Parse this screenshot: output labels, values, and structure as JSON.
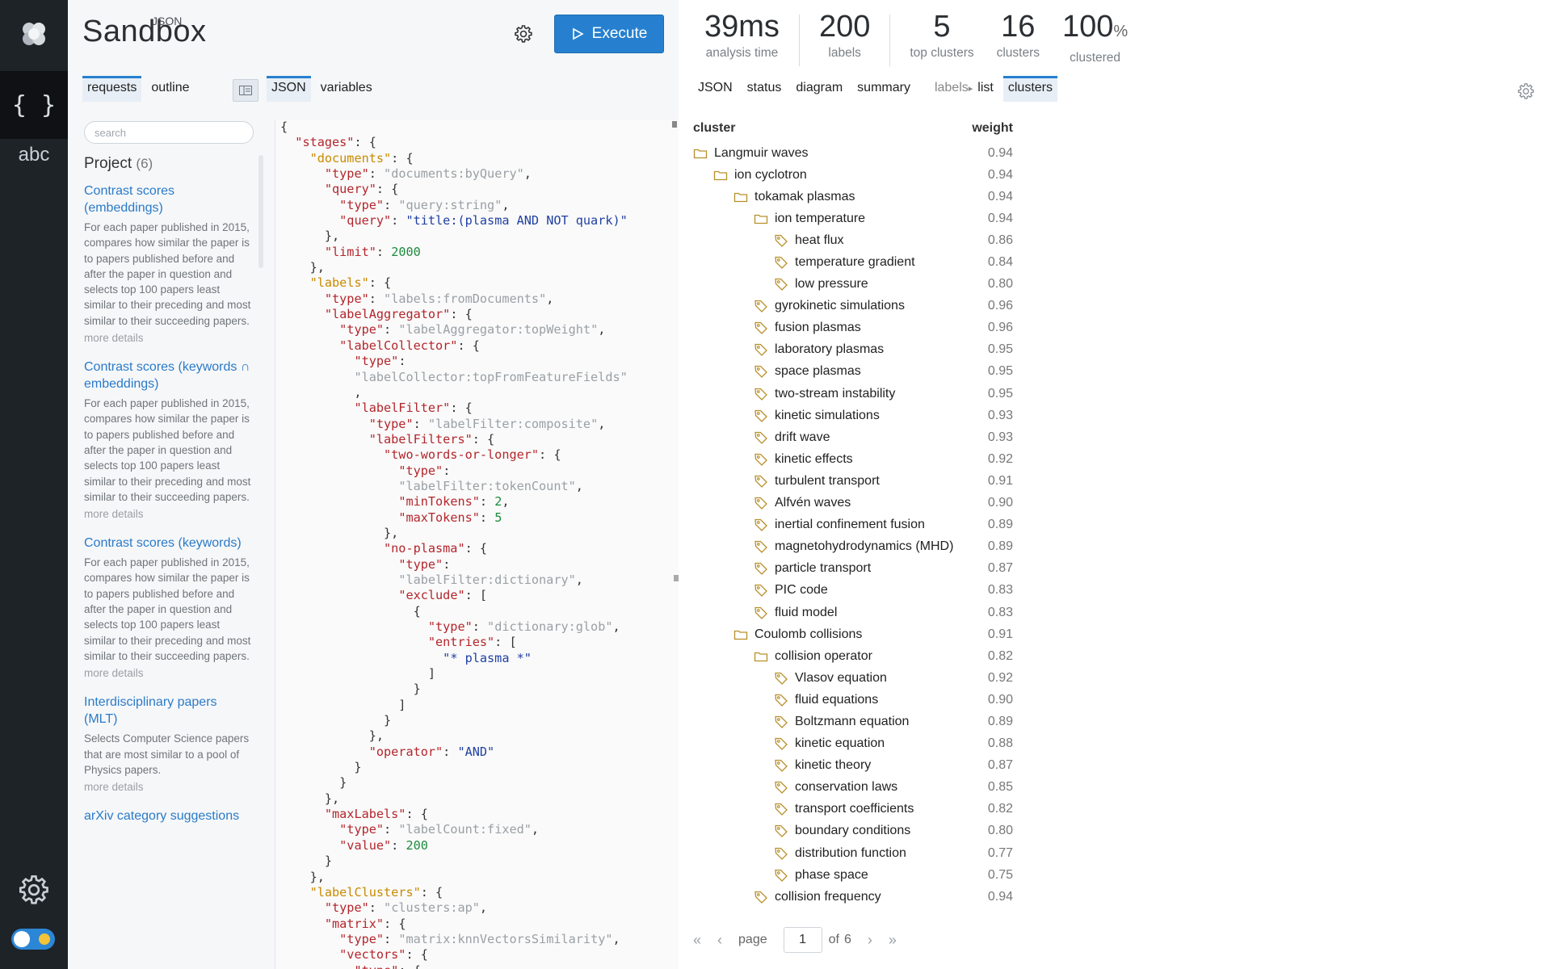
{
  "app": {
    "title": "Sandbox",
    "title_sup": "JSON"
  },
  "rail": {
    "json_icon": "{ }",
    "abc_label": "abc"
  },
  "toolbar": {
    "execute_label": "Execute"
  },
  "request_tabs": [
    "requests",
    "outline"
  ],
  "editor_tabs": [
    "JSON",
    "variables"
  ],
  "search": {
    "placeholder": "search",
    "value": ""
  },
  "project": {
    "heading": "Project",
    "count": "(6)",
    "items": [
      {
        "title": "Contrast scores (embeddings)",
        "desc": "For each paper published in 2015, compares how similar the paper is to papers published before and after the paper in question and selects top 100 papers least similar to their preceding and most similar to their succeeding papers.",
        "more": "more details"
      },
      {
        "title": "Contrast scores (keywords ∩ embeddings)",
        "desc": "For each paper published in 2015, compares how similar the paper is to papers published before and after the paper in question and selects top 100 papers least similar to their preceding and most similar to their succeeding papers.",
        "more": "more details"
      },
      {
        "title": "Contrast scores (keywords)",
        "desc": "For each paper published in 2015, compares how similar the paper is to papers published before and after the paper in question and selects top 100 papers least similar to their preceding and most similar to their succeeding papers.",
        "more": "more details"
      },
      {
        "title": "Interdisciplinary papers (MLT)",
        "desc": "Selects Computer Science papers that are most similar to a pool of Physics papers.",
        "more": "more details"
      },
      {
        "title": "arXiv category suggestions",
        "desc": "",
        "more": ""
      }
    ]
  },
  "stats": [
    {
      "value": "39",
      "unit": "ms",
      "label": "analysis time"
    },
    {
      "value": "200",
      "unit": "",
      "label": "labels"
    },
    {
      "value": "5",
      "unit": "",
      "label": "top clusters"
    },
    {
      "value": "16",
      "unit": "",
      "label": "clusters"
    },
    {
      "value": "100",
      "unit": "%",
      "label": "clustered"
    }
  ],
  "result_tabs": [
    "JSON",
    "status",
    "diagram",
    "summary",
    "labels",
    "list",
    "clusters"
  ],
  "table": {
    "col_cluster": "cluster",
    "col_weight": "weight",
    "rows": [
      {
        "depth": 0,
        "icon": "folder",
        "name": "Langmuir waves",
        "weight": "0.94"
      },
      {
        "depth": 1,
        "icon": "folder",
        "name": "ion cyclotron",
        "weight": "0.94"
      },
      {
        "depth": 2,
        "icon": "folder",
        "name": "tokamak plasmas",
        "weight": "0.94"
      },
      {
        "depth": 3,
        "icon": "folder",
        "name": "ion temperature",
        "weight": "0.94"
      },
      {
        "depth": 4,
        "icon": "tag",
        "name": "heat flux",
        "weight": "0.86"
      },
      {
        "depth": 4,
        "icon": "tag",
        "name": "temperature gradient",
        "weight": "0.84"
      },
      {
        "depth": 4,
        "icon": "tag",
        "name": "low pressure",
        "weight": "0.80"
      },
      {
        "depth": 3,
        "icon": "tag",
        "name": "gyrokinetic simulations",
        "weight": "0.96"
      },
      {
        "depth": 3,
        "icon": "tag",
        "name": "fusion plasmas",
        "weight": "0.96"
      },
      {
        "depth": 3,
        "icon": "tag",
        "name": "laboratory plasmas",
        "weight": "0.95"
      },
      {
        "depth": 3,
        "icon": "tag",
        "name": "space plasmas",
        "weight": "0.95"
      },
      {
        "depth": 3,
        "icon": "tag",
        "name": "two-stream instability",
        "weight": "0.95"
      },
      {
        "depth": 3,
        "icon": "tag",
        "name": "kinetic simulations",
        "weight": "0.93"
      },
      {
        "depth": 3,
        "icon": "tag",
        "name": "drift wave",
        "weight": "0.93"
      },
      {
        "depth": 3,
        "icon": "tag",
        "name": "kinetic effects",
        "weight": "0.92"
      },
      {
        "depth": 3,
        "icon": "tag",
        "name": "turbulent transport",
        "weight": "0.91"
      },
      {
        "depth": 3,
        "icon": "tag",
        "name": "Alfvén waves",
        "weight": "0.90"
      },
      {
        "depth": 3,
        "icon": "tag",
        "name": "inertial confinement fusion",
        "weight": "0.89"
      },
      {
        "depth": 3,
        "icon": "tag",
        "name": "magnetohydrodynamics (MHD)",
        "weight": "0.89"
      },
      {
        "depth": 3,
        "icon": "tag",
        "name": "particle transport",
        "weight": "0.87"
      },
      {
        "depth": 3,
        "icon": "tag",
        "name": "PIC code",
        "weight": "0.83"
      },
      {
        "depth": 3,
        "icon": "tag",
        "name": "fluid model",
        "weight": "0.83"
      },
      {
        "depth": 2,
        "icon": "folder",
        "name": "Coulomb collisions",
        "weight": "0.91"
      },
      {
        "depth": 3,
        "icon": "folder",
        "name": "collision operator",
        "weight": "0.82"
      },
      {
        "depth": 4,
        "icon": "tag",
        "name": "Vlasov equation",
        "weight": "0.92"
      },
      {
        "depth": 4,
        "icon": "tag",
        "name": "fluid equations",
        "weight": "0.90"
      },
      {
        "depth": 4,
        "icon": "tag",
        "name": "Boltzmann equation",
        "weight": "0.89"
      },
      {
        "depth": 4,
        "icon": "tag",
        "name": "kinetic equation",
        "weight": "0.88"
      },
      {
        "depth": 4,
        "icon": "tag",
        "name": "kinetic theory",
        "weight": "0.87"
      },
      {
        "depth": 4,
        "icon": "tag",
        "name": "conservation laws",
        "weight": "0.85"
      },
      {
        "depth": 4,
        "icon": "tag",
        "name": "transport coefficients",
        "weight": "0.82"
      },
      {
        "depth": 4,
        "icon": "tag",
        "name": "boundary conditions",
        "weight": "0.80"
      },
      {
        "depth": 4,
        "icon": "tag",
        "name": "distribution function",
        "weight": "0.77"
      },
      {
        "depth": 4,
        "icon": "tag",
        "name": "phase space",
        "weight": "0.75"
      },
      {
        "depth": 3,
        "icon": "tag",
        "name": "collision frequency",
        "weight": "0.94"
      }
    ]
  },
  "pager": {
    "page_label": "page",
    "page_value": "1",
    "of_label": "of",
    "total": "6"
  },
  "colors": {
    "accent": "#2680cf",
    "icon_gold": "#b8902a",
    "rail": "#1e2328"
  },
  "editor_code": [
    [
      [
        "p",
        "{"
      ]
    ],
    [
      [
        "p",
        "  "
      ],
      [
        "k",
        "\"stages\""
      ],
      [
        "p",
        ": {"
      ]
    ],
    [
      [
        "p",
        "    "
      ],
      [
        "k2",
        "\"documents\""
      ],
      [
        "p",
        ": {"
      ]
    ],
    [
      [
        "p",
        "      "
      ],
      [
        "k",
        "\"type\""
      ],
      [
        "p",
        ": "
      ],
      [
        "s",
        "\"documents:byQuery\""
      ],
      [
        "p",
        ","
      ]
    ],
    [
      [
        "p",
        "      "
      ],
      [
        "k",
        "\"query\""
      ],
      [
        "p",
        ": {"
      ]
    ],
    [
      [
        "p",
        "        "
      ],
      [
        "k",
        "\"type\""
      ],
      [
        "p",
        ": "
      ],
      [
        "s",
        "\"query:string\""
      ],
      [
        "p",
        ","
      ]
    ],
    [
      [
        "p",
        "        "
      ],
      [
        "k",
        "\"query\""
      ],
      [
        "p",
        ": "
      ],
      [
        "v",
        "\"title:(plasma AND NOT quark)\""
      ]
    ],
    [
      [
        "p",
        "      },"
      ]
    ],
    [
      [
        "p",
        "      "
      ],
      [
        "k",
        "\"limit\""
      ],
      [
        "p",
        ": "
      ],
      [
        "n",
        "2000"
      ]
    ],
    [
      [
        "p",
        "    },"
      ]
    ],
    [
      [
        "p",
        "    "
      ],
      [
        "k2",
        "\"labels\""
      ],
      [
        "p",
        ": {"
      ]
    ],
    [
      [
        "p",
        "      "
      ],
      [
        "k",
        "\"type\""
      ],
      [
        "p",
        ": "
      ],
      [
        "s",
        "\"labels:fromDocuments\""
      ],
      [
        "p",
        ","
      ]
    ],
    [
      [
        "p",
        "      "
      ],
      [
        "k",
        "\"labelAggregator\""
      ],
      [
        "p",
        ": {"
      ]
    ],
    [
      [
        "p",
        "        "
      ],
      [
        "k",
        "\"type\""
      ],
      [
        "p",
        ": "
      ],
      [
        "s",
        "\"labelAggregator:topWeight\""
      ],
      [
        "p",
        ","
      ]
    ],
    [
      [
        "p",
        "        "
      ],
      [
        "k",
        "\"labelCollector\""
      ],
      [
        "p",
        ": {"
      ]
    ],
    [
      [
        "p",
        "          "
      ],
      [
        "k",
        "\"type\""
      ],
      [
        "p",
        ":"
      ]
    ],
    [
      [
        "p",
        "          "
      ],
      [
        "s",
        "\"labelCollector:topFromFeatureFields\""
      ]
    ],
    [
      [
        "p",
        "          ,"
      ]
    ],
    [
      [
        "p",
        "          "
      ],
      [
        "k",
        "\"labelFilter\""
      ],
      [
        "p",
        ": {"
      ]
    ],
    [
      [
        "p",
        "            "
      ],
      [
        "k",
        "\"type\""
      ],
      [
        "p",
        ": "
      ],
      [
        "s",
        "\"labelFilter:composite\""
      ],
      [
        "p",
        ","
      ]
    ],
    [
      [
        "p",
        "            "
      ],
      [
        "k",
        "\"labelFilters\""
      ],
      [
        "p",
        ": {"
      ]
    ],
    [
      [
        "p",
        "              "
      ],
      [
        "k",
        "\"two-words-or-longer\""
      ],
      [
        "p",
        ": {"
      ]
    ],
    [
      [
        "p",
        "                "
      ],
      [
        "k",
        "\"type\""
      ],
      [
        "p",
        ":"
      ]
    ],
    [
      [
        "p",
        "                "
      ],
      [
        "s",
        "\"labelFilter:tokenCount\""
      ],
      [
        "p",
        ","
      ]
    ],
    [
      [
        "p",
        "                "
      ],
      [
        "k",
        "\"minTokens\""
      ],
      [
        "p",
        ": "
      ],
      [
        "n",
        "2"
      ],
      [
        "p",
        ","
      ]
    ],
    [
      [
        "p",
        "                "
      ],
      [
        "k",
        "\"maxTokens\""
      ],
      [
        "p",
        ": "
      ],
      [
        "n",
        "5"
      ]
    ],
    [
      [
        "p",
        "              },"
      ]
    ],
    [
      [
        "p",
        "              "
      ],
      [
        "k",
        "\"no-plasma\""
      ],
      [
        "p",
        ": {"
      ]
    ],
    [
      [
        "p",
        "                "
      ],
      [
        "k",
        "\"type\""
      ],
      [
        "p",
        ":"
      ]
    ],
    [
      [
        "p",
        "                "
      ],
      [
        "s",
        "\"labelFilter:dictionary\""
      ],
      [
        "p",
        ","
      ]
    ],
    [
      [
        "p",
        "                "
      ],
      [
        "k",
        "\"exclude\""
      ],
      [
        "p",
        ": ["
      ]
    ],
    [
      [
        "p",
        "                  {"
      ]
    ],
    [
      [
        "p",
        "                    "
      ],
      [
        "k",
        "\"type\""
      ],
      [
        "p",
        ": "
      ],
      [
        "s",
        "\"dictionary:glob\""
      ],
      [
        "p",
        ","
      ]
    ],
    [
      [
        "p",
        "                    "
      ],
      [
        "k",
        "\"entries\""
      ],
      [
        "p",
        ": ["
      ]
    ],
    [
      [
        "p",
        "                      "
      ],
      [
        "v",
        "\"* plasma *\""
      ]
    ],
    [
      [
        "p",
        "                    ]"
      ]
    ],
    [
      [
        "p",
        "                  }"
      ]
    ],
    [
      [
        "p",
        "                ]"
      ]
    ],
    [
      [
        "p",
        "              }"
      ]
    ],
    [
      [
        "p",
        "            },"
      ]
    ],
    [
      [
        "p",
        "            "
      ],
      [
        "k",
        "\"operator\""
      ],
      [
        "p",
        ": "
      ],
      [
        "v",
        "\"AND\""
      ]
    ],
    [
      [
        "p",
        "          }"
      ]
    ],
    [
      [
        "p",
        "        }"
      ]
    ],
    [
      [
        "p",
        "      },"
      ]
    ],
    [
      [
        "p",
        "      "
      ],
      [
        "k",
        "\"maxLabels\""
      ],
      [
        "p",
        ": {"
      ]
    ],
    [
      [
        "p",
        "        "
      ],
      [
        "k",
        "\"type\""
      ],
      [
        "p",
        ": "
      ],
      [
        "s",
        "\"labelCount:fixed\""
      ],
      [
        "p",
        ","
      ]
    ],
    [
      [
        "p",
        "        "
      ],
      [
        "k",
        "\"value\""
      ],
      [
        "p",
        ": "
      ],
      [
        "n",
        "200"
      ]
    ],
    [
      [
        "p",
        "      }"
      ]
    ],
    [
      [
        "p",
        "    },"
      ]
    ],
    [
      [
        "p",
        "    "
      ],
      [
        "k2",
        "\"labelClusters\""
      ],
      [
        "p",
        ": {"
      ]
    ],
    [
      [
        "p",
        "      "
      ],
      [
        "k",
        "\"type\""
      ],
      [
        "p",
        ": "
      ],
      [
        "s",
        "\"clusters:ap\""
      ],
      [
        "p",
        ","
      ]
    ],
    [
      [
        "p",
        "      "
      ],
      [
        "k",
        "\"matrix\""
      ],
      [
        "p",
        ": {"
      ]
    ],
    [
      [
        "p",
        "        "
      ],
      [
        "k",
        "\"type\""
      ],
      [
        "p",
        ": "
      ],
      [
        "s",
        "\"matrix:knnVectorsSimilarity\""
      ],
      [
        "p",
        ","
      ]
    ],
    [
      [
        "p",
        "        "
      ],
      [
        "k",
        "\"vectors\""
      ],
      [
        "p",
        ": {"
      ]
    ],
    [
      [
        "p",
        "          "
      ],
      [
        "k",
        "\"type\""
      ],
      [
        "p",
        ": {"
      ]
    ]
  ]
}
